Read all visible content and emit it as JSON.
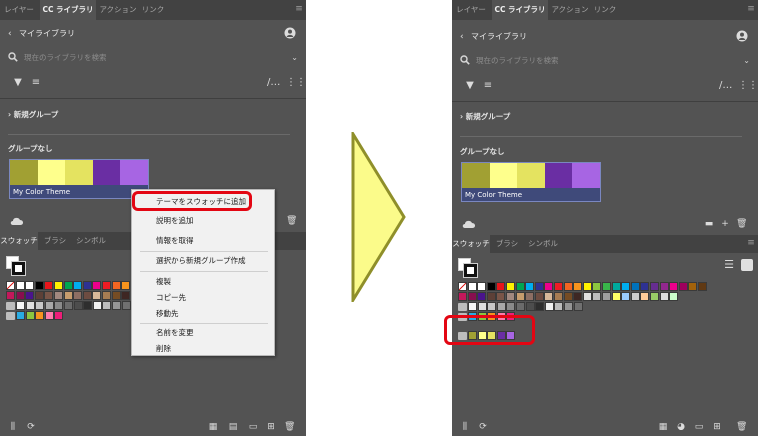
{
  "panels": {
    "tabs": [
      "レイヤー",
      "CC ライブラリ",
      "アクション",
      "リンク"
    ],
    "library_title": "マイライブラリ",
    "search_placeholder": "現在のライブラリを検索",
    "group_new": "新規グループ",
    "group_none": "グループなし",
    "theme_name": "My Color Theme",
    "theme_colors": [
      "#a1a033",
      "#feff8c",
      "#e4e360",
      "#6a2ea3",
      "#a765e3"
    ],
    "swatch_tabs": [
      "スウォッチ",
      "ブラシ",
      "シンボル"
    ]
  },
  "context_menu": {
    "items": [
      "テーマをスウォッチに追加",
      "説明を追加",
      "情報を取得",
      "選択から新規グループ作成",
      "複製",
      "コピー先",
      "移動先",
      "名前を変更",
      "削除"
    ]
  },
  "colors": {
    "panel_bg": "#535353",
    "tabbar_bg": "#424242",
    "highlight": "#e30613",
    "arrow_fill": "#fbfb8a",
    "arrow_stroke": "#8f8f2a"
  },
  "icons": [
    "chevron-left-icon",
    "person-icon",
    "search-icon",
    "chevron-down-icon",
    "filter-icon",
    "sort-icon",
    "tool-icon",
    "chevron-right-icon",
    "cloud-icon",
    "folder-icon",
    "add-icon",
    "trash-icon",
    "menu-icon",
    "list-view-icon",
    "grid-view-icon",
    "library-icon",
    "swatch-options-icon",
    "new-swatch-icon"
  ]
}
